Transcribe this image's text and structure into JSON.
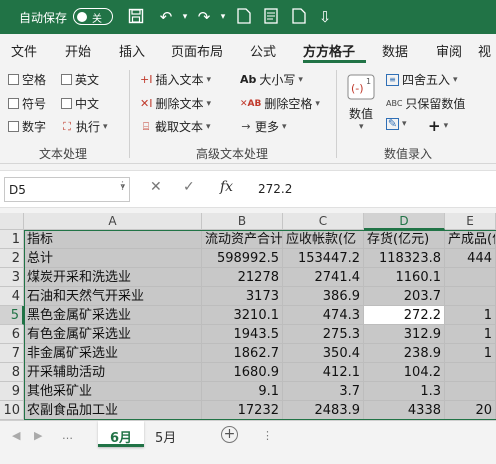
{
  "titlebar": {
    "autosave_label": "自动保存",
    "toggle_state": "关"
  },
  "tabs": [
    "文件",
    "开始",
    "插入",
    "页面布局",
    "公式",
    "方方格子",
    "数据",
    "审阅",
    "视"
  ],
  "active_tab": "方方格子",
  "ribbon": {
    "text_group": {
      "label": "文本处理",
      "checkboxes": [
        "空格",
        "英文",
        "符号",
        "中文",
        "数字"
      ],
      "execute": "执行"
    },
    "advanced_group": {
      "label": "高级文本处理",
      "insert_text": "插入文本",
      "delete_text": "删除文本",
      "extract_text": "截取文本",
      "case": "大小写",
      "delete_spaces": "删除空格",
      "more": "更多"
    },
    "number_group": {
      "label": "数值录入",
      "numeric": "数值",
      "round": "四舍五入",
      "keep_numeric": "只保留数值"
    }
  },
  "formula_bar": {
    "name_box": "D5",
    "formula": "272.2"
  },
  "sheet": {
    "columns": [
      "A",
      "B",
      "C",
      "D",
      "E"
    ],
    "rows": [
      {
        "n": "1",
        "cells": [
          "指标",
          "流动资产合计",
          "应收帐款(亿",
          "存货(亿元)",
          "产成品(亿"
        ]
      },
      {
        "n": "2",
        "cells": [
          "总计",
          "598992.5",
          "153447.2",
          "118323.8",
          "444"
        ]
      },
      {
        "n": "3",
        "cells": [
          "煤炭开采和洗选业",
          "21278",
          "2741.4",
          "1160.1",
          ""
        ]
      },
      {
        "n": "4",
        "cells": [
          "石油和天然气开采业",
          "3173",
          "386.9",
          "203.7",
          ""
        ]
      },
      {
        "n": "5",
        "cells": [
          "黑色金属矿采选业",
          "3210.1",
          "474.3",
          "272.2",
          "1"
        ]
      },
      {
        "n": "6",
        "cells": [
          "有色金属矿采选业",
          "1943.5",
          "275.3",
          "312.9",
          "1"
        ]
      },
      {
        "n": "7",
        "cells": [
          "非金属矿采选业",
          "1862.7",
          "350.4",
          "238.9",
          "1"
        ]
      },
      {
        "n": "8",
        "cells": [
          "开采辅助活动",
          "1680.9",
          "412.1",
          "104.2",
          ""
        ]
      },
      {
        "n": "9",
        "cells": [
          "其他采矿业",
          "9.1",
          "3.7",
          "1.3",
          ""
        ]
      },
      {
        "n": "10",
        "cells": [
          "农副食品加工业",
          "17232",
          "2483.9",
          "4338",
          "20"
        ]
      }
    ]
  },
  "sheet_tabs": [
    "6月",
    "5月"
  ],
  "active_sheet": "6月"
}
